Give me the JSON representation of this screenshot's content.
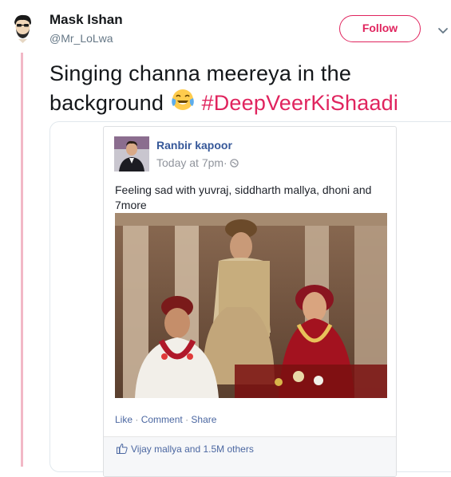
{
  "author": {
    "name": "Mask Ishan",
    "handle": "@Mr_LoLwa",
    "avatar_icon": "bearded-man-avatar"
  },
  "follow_button": {
    "label": "Follow"
  },
  "menu": {
    "icon": "chevron-down-icon"
  },
  "tweet": {
    "text_line1": "Singing channa meereya in the",
    "text_line2": "background",
    "emoji": "tears-of-joy-emoji",
    "hashtag": "#DeepVeerKiShaadi"
  },
  "fb_post": {
    "author": "Ranbir kapoor",
    "time": "Today at 7pm·",
    "privacy_icon": "globe-icon",
    "status_line1": "Feeling sad with yuvraj, siddharth mallya, dhoni and",
    "status_line2": "7more",
    "photo_description_icon": "wedding-photo",
    "actions": {
      "like": "Like",
      "comment": "Comment",
      "share": "Share",
      "separator": "·"
    },
    "likes_text": "Vijay mallya and 1.5M others"
  },
  "colors": {
    "accent": "#e0245e",
    "fb_blue": "#365899",
    "thread_line": "#f2b8c6"
  }
}
